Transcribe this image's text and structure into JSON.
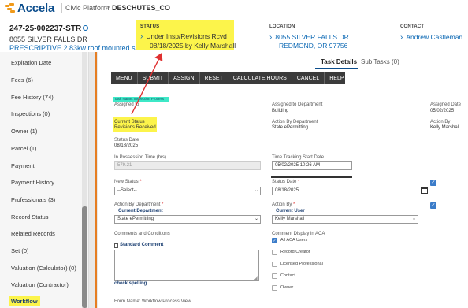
{
  "topbar": {
    "logo_text": "Accela",
    "platform": "Civic Platform",
    "separator": ">",
    "agency": "DESCHUTES_CO"
  },
  "record": {
    "id": "247-25-002237-STR",
    "address": "8055 SILVER FALLS DR",
    "description": "PRESCRIPTIVE 2.83kw roof mounted solar ..."
  },
  "status": {
    "label": "STATUS",
    "line1": "Under Insp/Revisions Rcvd",
    "line2": "08/18/2025 by Kelly Marshall"
  },
  "location": {
    "label": "LOCATION",
    "line1": "8055 SILVER FALLS DR",
    "line2": "REDMOND, OR 97756"
  },
  "contact": {
    "label": "CONTACT",
    "name": "Andrew Castleman"
  },
  "sidebar": {
    "items": [
      {
        "label": "Expiration Date"
      },
      {
        "label": "Fees (6)"
      },
      {
        "label": "Fee History (74)"
      },
      {
        "label": "Inspections (0)"
      },
      {
        "label": "Owner (1)"
      },
      {
        "label": "Parcel (1)"
      },
      {
        "label": "Payment"
      },
      {
        "label": "Payment History"
      },
      {
        "label": "Professionals (3)"
      },
      {
        "label": "Record Status"
      },
      {
        "label": "Related Records"
      },
      {
        "label": "Set (0)"
      },
      {
        "label": "Valuation (Calculator) (0)"
      },
      {
        "label": "Valuation (Contractor)"
      },
      {
        "label": "Workflow"
      }
    ]
  },
  "tabs": [
    {
      "label": "Task Details"
    },
    {
      "label": "Sub Tasks (0)"
    }
  ],
  "toolbar": {
    "menu": "MENU",
    "submit": "SUBMIT",
    "assign": "ASSIGN",
    "reset": "RESET",
    "calc": "CALCULATE HOURS",
    "cancel": "CANCEL",
    "help": "HELP"
  },
  "form": {
    "task_name": "Task Name: Inspection Process",
    "assigned_to_label": "Assigned to",
    "assigned_dept_label": "Assigned to Department",
    "assigned_dept_value": "Building",
    "assigned_date_label": "Assigned Date",
    "assigned_date_value": "05/02/2025",
    "current_status_label": "Current Status",
    "current_status_value": "Revisions Received",
    "action_by_dept_label": "Action By Department",
    "action_by_dept_value": "State ePermitting",
    "action_by_label": "Action By",
    "action_by_value": "Kelly Marshall",
    "status_date_label": "Status Date",
    "status_date_value": "08/18/2025",
    "in_possession_label": "In Possession Time (hrs)",
    "in_possession_value": "579.21",
    "time_tracking_label": "Time Tracking Start Date",
    "time_tracking_value": "05/02/2025 10:26 AM",
    "new_status_label": "New Status",
    "new_status_value": "--Select--",
    "status_date2_label": "Status Date",
    "status_date2_value": "08/18/2025",
    "action_by_dept2_label": "Action By Department",
    "current_department": "Current Department",
    "action_by_dept2_value": "State ePermitting",
    "action_by2_label": "Action By",
    "current_user": "Current User",
    "action_by2_value": "Kelly Marshall",
    "comments_label": "Comments and Conditions",
    "standard_comment": "Standard Comment",
    "check_spelling": "check spelling",
    "comment_display_label": "Comment Display in ACA",
    "required_mark": "*",
    "form_name": "Form Name: Workflow Process View"
  },
  "aca_options": [
    {
      "label": "All ACA Users",
      "checked": true
    },
    {
      "label": "Record Creator",
      "checked": false
    },
    {
      "label": "Licensed Professional",
      "checked": false
    },
    {
      "label": "Contact",
      "checked": false
    },
    {
      "label": "Owner",
      "checked": false
    }
  ],
  "colors": {
    "highlight": "#fcf44b",
    "accent_blue": "#0b68b4",
    "toolbar_bg": "#3b3b3b",
    "arrow_red": "#e03030",
    "task_highlight": "#3ee8c7"
  },
  "icons": {
    "logo": "accela-logo-icon",
    "record_circle": "circle-icon",
    "chevron": "chevron-right-icon",
    "calendar": "calendar-icon",
    "standard_comment": "document-icon"
  }
}
